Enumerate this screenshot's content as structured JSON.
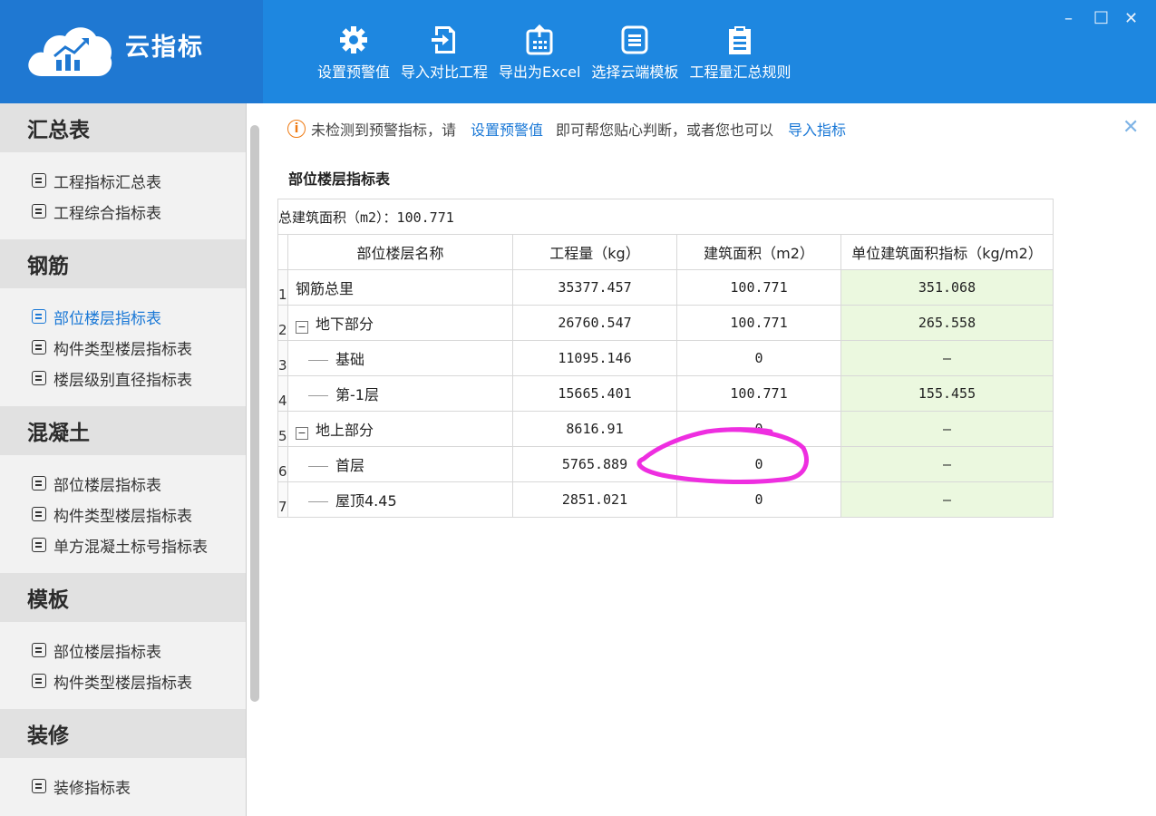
{
  "app": {
    "title": "云指标"
  },
  "toolbar": [
    {
      "label": "设置预警值",
      "icon": "gear-icon"
    },
    {
      "label": "导入对比工程",
      "icon": "import-icon"
    },
    {
      "label": "导出为Excel",
      "icon": "export-excel-icon"
    },
    {
      "label": "选择云端模板",
      "icon": "template-icon"
    },
    {
      "label": "工程量汇总规则",
      "icon": "clipboard-icon"
    }
  ],
  "window": {
    "minimize": "–",
    "maximize": "□",
    "close": "✕"
  },
  "sidebar": [
    {
      "title": "汇总表",
      "items": [
        "工程指标汇总表",
        "工程综合指标表"
      ]
    },
    {
      "title": "钢筋",
      "items": [
        "部位楼层指标表",
        "构件类型楼层指标表",
        "楼层级别直径指标表"
      ]
    },
    {
      "title": "混凝土",
      "items": [
        "部位楼层指标表",
        "构件类型楼层指标表",
        "单方混凝土标号指标表"
      ]
    },
    {
      "title": "模板",
      "items": [
        "部位楼层指标表",
        "构件类型楼层指标表"
      ]
    },
    {
      "title": "装修",
      "items": [
        "装修指标表"
      ]
    }
  ],
  "notice": {
    "text1": "未检测到预警指标，请",
    "link1": "设置预警值",
    "text2": "即可帮您贴心判断，或者您也可以",
    "link2": "导入指标",
    "close": "✕"
  },
  "section_title": "部位楼层指标表",
  "table": {
    "summary": "总建筑面积（m2）：100.771",
    "headers": [
      "部位楼层名称",
      "工程量（kg）",
      "建筑面积（m2）",
      "单位建筑面积指标（kg/m2）"
    ],
    "rows": [
      {
        "idx": "1",
        "name": "钢筋总里",
        "qty": "35377.457",
        "area": "100.771",
        "index": "351.068"
      },
      {
        "idx": "2",
        "name": "地下部分",
        "qty": "26760.547",
        "area": "100.771",
        "index": "265.558",
        "toggle": "−"
      },
      {
        "idx": "3",
        "name": "基础",
        "qty": "11095.146",
        "area": "0",
        "index": "–"
      },
      {
        "idx": "4",
        "name": "第-1层",
        "qty": "15665.401",
        "area": "100.771",
        "index": "155.455"
      },
      {
        "idx": "5",
        "name": "地上部分",
        "qty": "8616.91",
        "area": "0",
        "index": "–",
        "toggle": "−"
      },
      {
        "idx": "6",
        "name": "首层",
        "qty": "5765.889",
        "area": "0",
        "index": "–"
      },
      {
        "idx": "7",
        "name": "屋顶4.45",
        "qty": "2851.021",
        "area": "0",
        "index": "–"
      }
    ]
  },
  "colors": {
    "header": "#1e87e0",
    "logo_bg": "#1f78d2",
    "accent": "#1a78d6",
    "green_cell": "#ebf8df",
    "annotation": "#ee2ee0"
  }
}
